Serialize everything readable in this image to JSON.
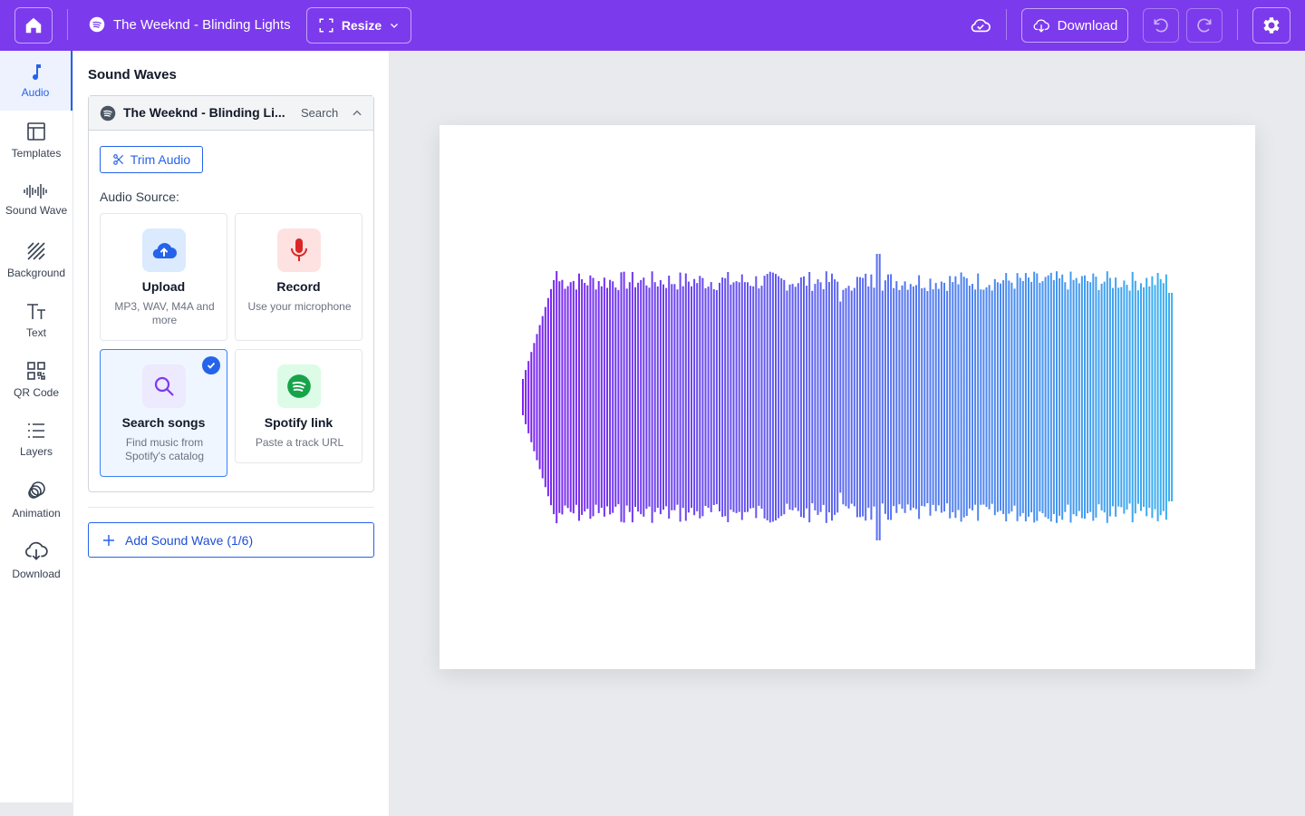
{
  "topbar": {
    "title": "The Weeknd - Blinding Lights",
    "resize_label": "Resize",
    "download_label": "Download"
  },
  "rail": {
    "items": [
      {
        "label": "Audio",
        "icon": "music-note-icon",
        "active": true
      },
      {
        "label": "Templates",
        "icon": "templates-icon"
      },
      {
        "label": "Sound Wave",
        "icon": "sound-wave-icon"
      },
      {
        "label": "Background",
        "icon": "background-icon"
      },
      {
        "label": "Text",
        "icon": "text-icon"
      },
      {
        "label": "QR Code",
        "icon": "qr-code-icon"
      },
      {
        "label": "Layers",
        "icon": "layers-icon"
      },
      {
        "label": "Animation",
        "icon": "animation-icon"
      },
      {
        "label": "Download",
        "icon": "download-icon"
      }
    ]
  },
  "panel": {
    "title": "Sound Waves",
    "card": {
      "track_name": "The Weeknd - Blinding Li...",
      "search_label": "Search",
      "trim_label": "Trim Audio",
      "source_label": "Audio Source:",
      "options": [
        {
          "title": "Upload",
          "desc": "MP3, WAV, M4A and more",
          "icon": "cloud-upload-icon"
        },
        {
          "title": "Record",
          "desc": "Use your microphone",
          "icon": "microphone-icon"
        },
        {
          "title": "Search songs",
          "desc": "Find music from Spotify's catalog",
          "icon": "search-icon",
          "selected": true
        },
        {
          "title": "Spotify link",
          "desc": "Paste a track URL",
          "icon": "spotify-icon"
        }
      ]
    },
    "add_label": "Add Sound Wave (1/6)"
  },
  "colors": {
    "topbar": "#7c3aed",
    "accent": "#2563eb",
    "wave_start": "#7c22f0",
    "wave_end": "#3ab0f0"
  }
}
